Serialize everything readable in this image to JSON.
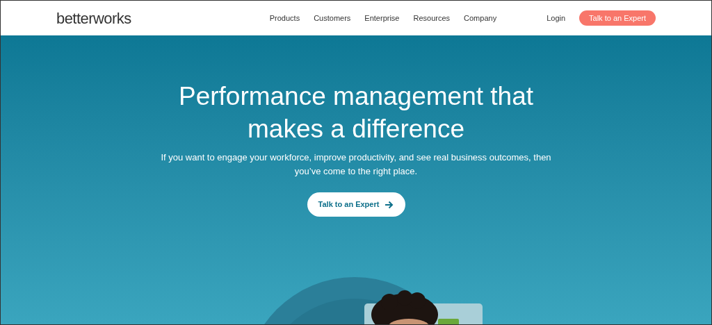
{
  "header": {
    "logo": "betterworks",
    "nav": [
      "Products",
      "Customers",
      "Enterprise",
      "Resources",
      "Company"
    ],
    "login": "Login",
    "cta": "Talk to an Expert"
  },
  "hero": {
    "title_lines": [
      "Performance management that",
      "makes a difference"
    ],
    "subtitle": "If you want to engage your workforce, improve productivity, and see real business outcomes, then you’ve come to the right place.",
    "button": "Talk to an Expert"
  }
}
